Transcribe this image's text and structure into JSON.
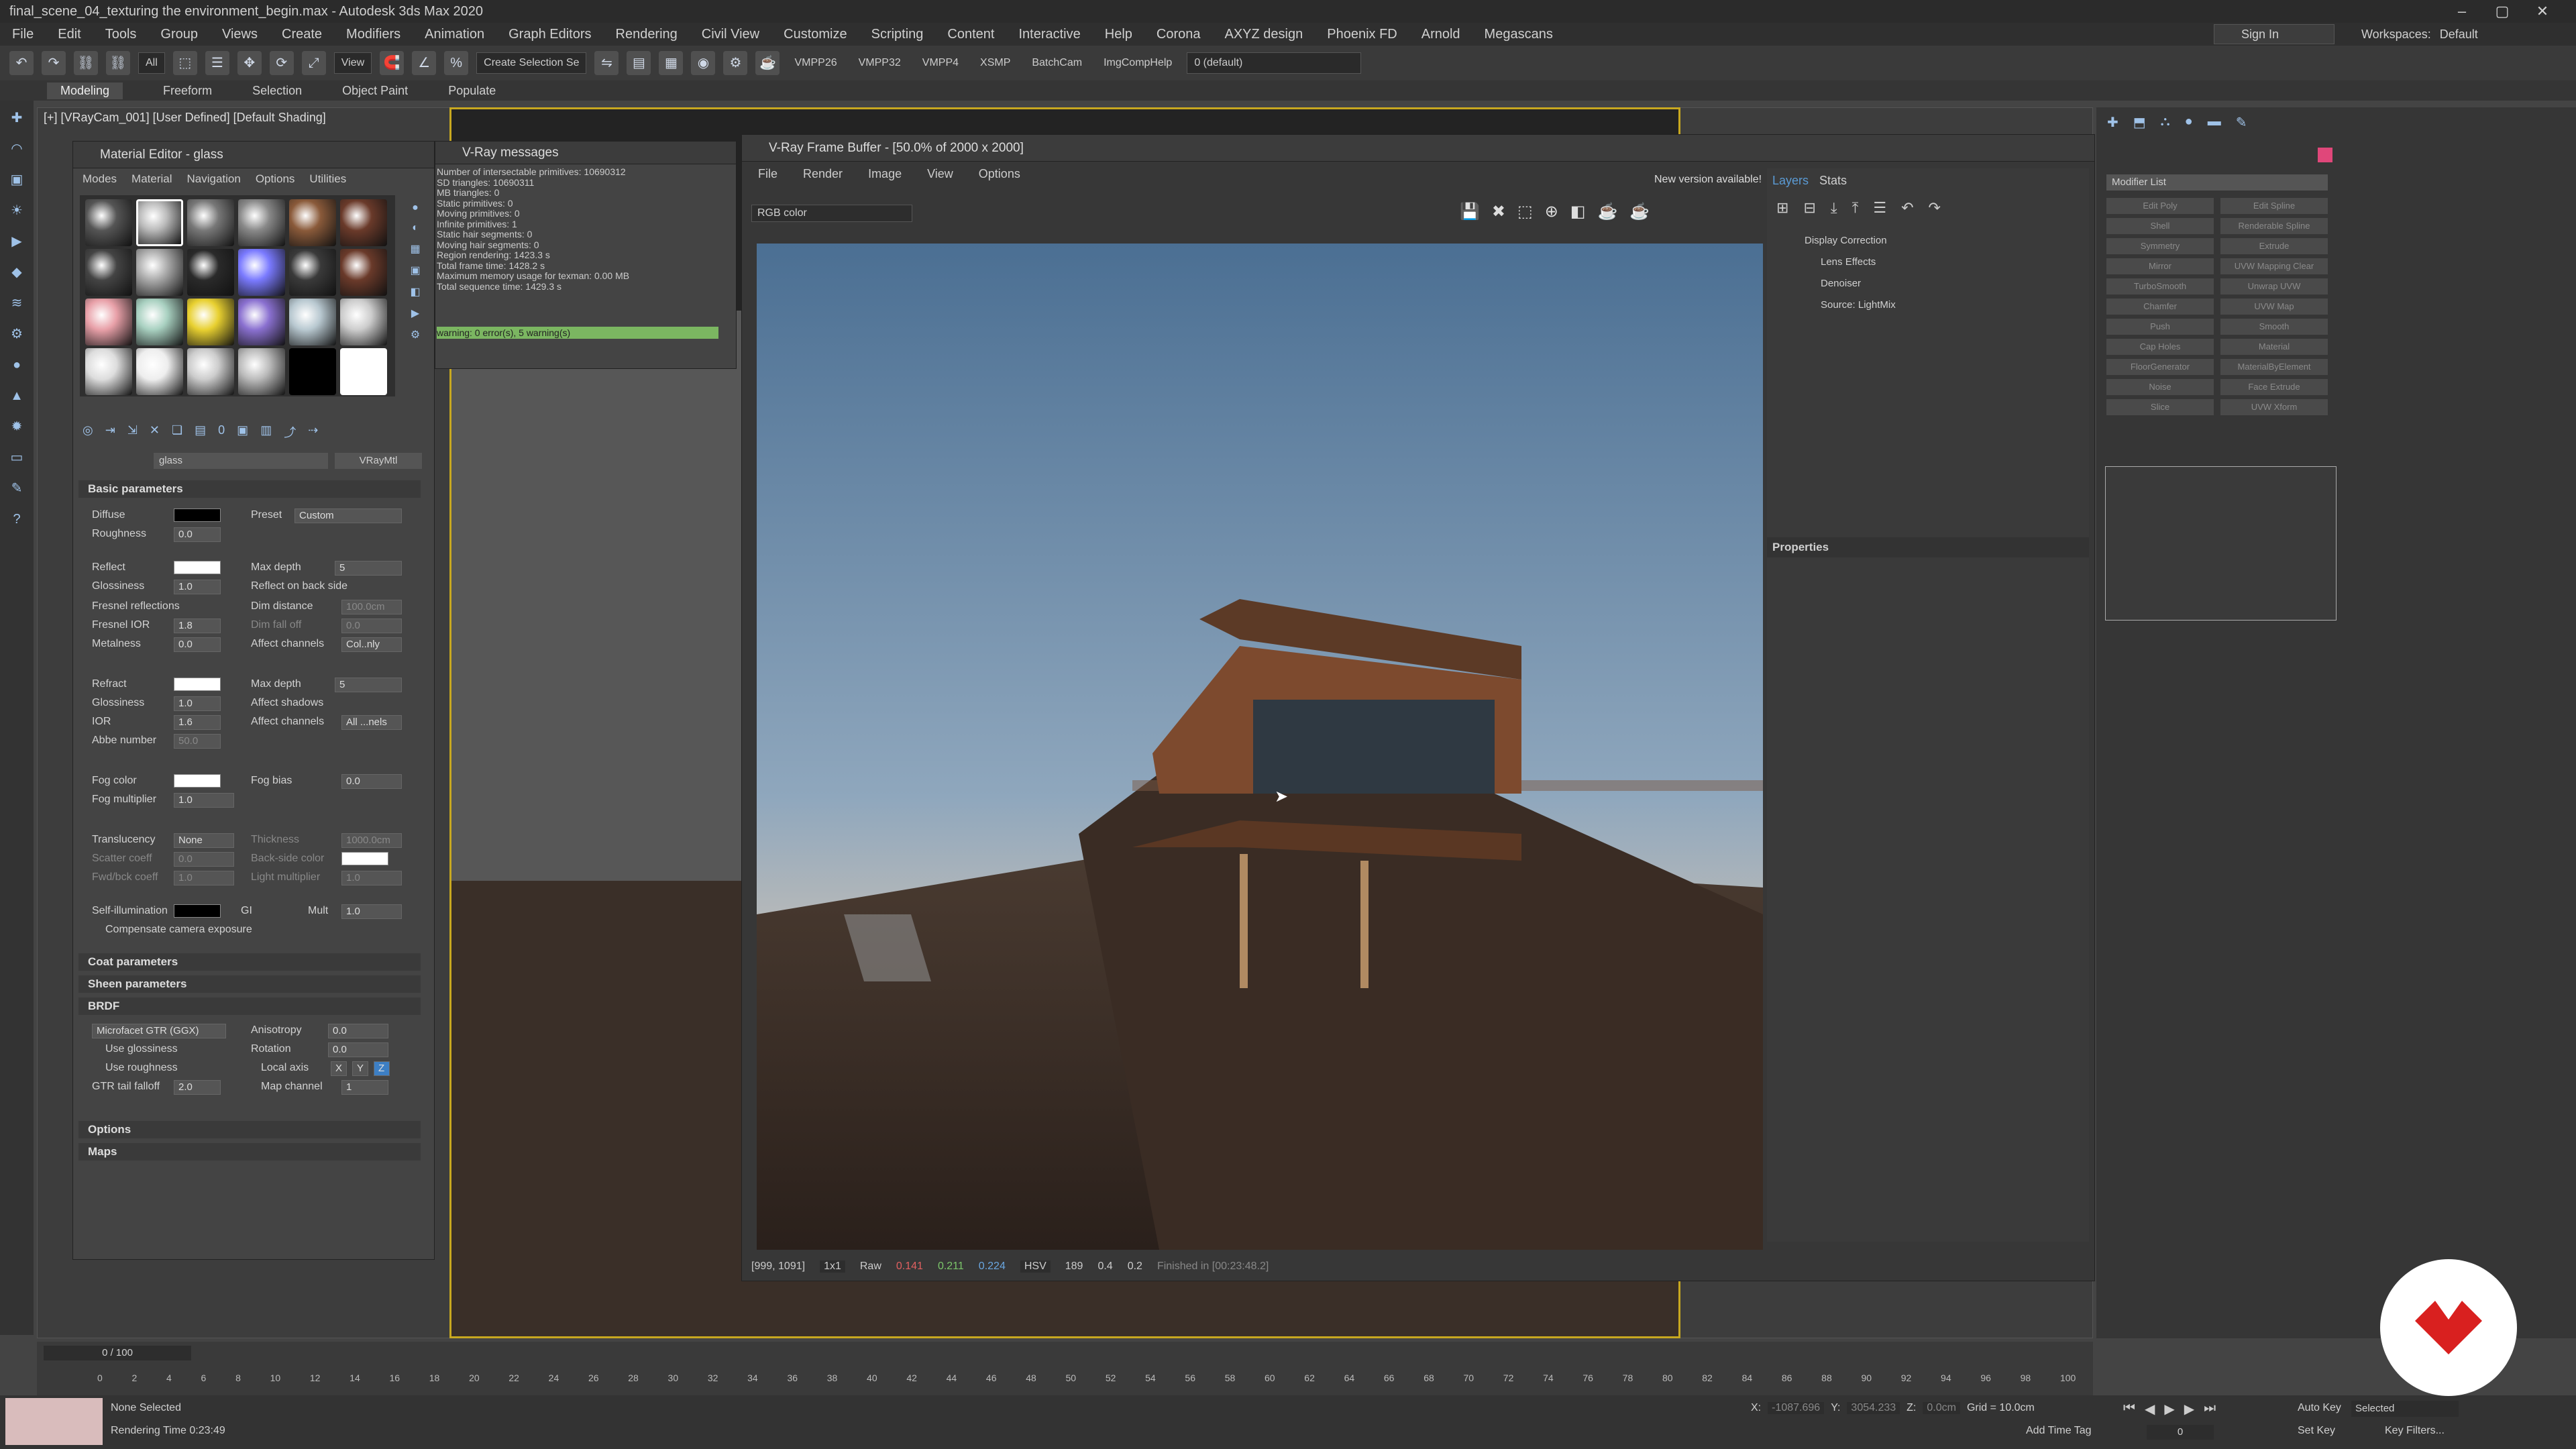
{
  "window": {
    "title": "final_scene_04_texturing the environment_begin.max - Autodesk 3ds Max 2020",
    "controls": [
      "–",
      "▢",
      "✕"
    ]
  },
  "menu": [
    "File",
    "Edit",
    "Tools",
    "Group",
    "Views",
    "Create",
    "Modifiers",
    "Animation",
    "Graph Editors",
    "Rendering",
    "Civil View",
    "Customize",
    "Scripting",
    "Content",
    "Interactive",
    "Help",
    "Corona",
    "AXYZ design",
    "Phoenix FD",
    "Arnold",
    "Megascans"
  ],
  "account": {
    "sign_in": "Sign In",
    "workspaces_label": "Workspaces:",
    "workspace": "Default"
  },
  "toolbar": {
    "selection_filter": "All",
    "ref_coord": "View",
    "create_selection_set": "Create Selection Se",
    "layer": "0 (default)",
    "scripts": [
      "VMPP26",
      "VMPP32",
      "VMPP4",
      "XSMP",
      "BatchCam",
      "ImgCompHelp"
    ]
  },
  "ribbon_tabs": [
    "Modeling",
    "Freeform",
    "Selection",
    "Object Paint",
    "Populate"
  ],
  "viewport": {
    "label": "[+] [VRayCam_001] [User Defined] [Default Shading]"
  },
  "material_editor": {
    "title": "Material Editor - glass",
    "menu": [
      "Modes",
      "Material",
      "Navigation",
      "Options",
      "Utilities"
    ],
    "material_name": "glass",
    "material_type": "VRayMtl",
    "basic_params_title": "Basic parameters",
    "diffuse_label": "Diffuse",
    "preset_label": "Preset",
    "preset_value": "Custom",
    "roughness_label": "Roughness",
    "roughness": "0.0",
    "reflect_label": "Reflect",
    "max_depth_label": "Max depth",
    "reflect_max_depth": "5",
    "glossiness_label": "Glossiness",
    "reflect_glossiness": "1.0",
    "reflect_back_side": "Reflect on back side",
    "fresnel_reflections": "Fresnel reflections",
    "dim_distance": "Dim distance",
    "dim_distance_value": "100.0cm",
    "fresnel_ior_label": "Fresnel IOR",
    "fresnel_ior": "1.8",
    "dim_falloff": "Dim fall off",
    "dim_falloff_value": "0.0",
    "metalness_label": "Metalness",
    "metalness": "0.0",
    "affect_channels_label": "Affect channels",
    "reflect_affect": "Col..nly",
    "refract_label": "Refract",
    "refract_max_depth": "5",
    "refract_glossiness": "1.0",
    "affect_shadows": "Affect shadows",
    "ior_label": "IOR",
    "ior": "1.6",
    "refract_affect": "All ...nels",
    "abbe_label": "Abbe number",
    "abbe": "50.0",
    "fog_color_label": "Fog color",
    "fog_bias_label": "Fog bias",
    "fog_bias": "0.0",
    "fog_mult_label": "Fog multiplier",
    "fog_mult": "1.0",
    "translucency_label": "Translucency",
    "translucency": "None",
    "thickness_label": "Thickness",
    "thickness": "1000.0cm",
    "scatter_label": "Scatter coeff",
    "scatter": "0.0",
    "backside_label": "Back-side color",
    "fwdbck_label": "Fwd/bck coeff",
    "fwdbck": "1.0",
    "light_mult_label": "Light multiplier",
    "light_mult": "1.0",
    "self_illum_label": "Self-illumination",
    "gi_label": "GI",
    "mult_label": "Mult",
    "mult": "1.0",
    "compensate_label": "Compensate camera exposure",
    "rollouts": [
      "Coat parameters",
      "Sheen parameters",
      "BRDF"
    ],
    "brdf_type": "Microfacet GTR (GGX)",
    "anisotropy_label": "Anisotropy",
    "anisotropy": "0.0",
    "use_glossiness": "Use glossiness",
    "rotation_label": "Rotation",
    "rotation": "0.0",
    "use_roughness": "Use roughness",
    "local_axis_label": "Local axis",
    "axis_x": "X",
    "axis_y": "Y",
    "axis_z": "Z",
    "gtr_falloff_label": "GTR tail falloff",
    "gtr_falloff": "2.0",
    "map_channel_label": "Map channel",
    "map_channel": "1",
    "rollouts_bottom": [
      "Options",
      "Maps"
    ]
  },
  "vray_messages": {
    "title": "V-Ray messages",
    "lines": [
      "Number of intersectable primitives: 10690312",
      "SD triangles: 10690311",
      "MB triangles: 0",
      "Static primitives: 0",
      "Moving primitives: 0",
      "Infinite primitives: 1",
      "Static hair segments: 0",
      "Moving hair segments: 0",
      "Region rendering: 1423.3 s",
      "Total frame time: 1428.2 s",
      "Maximum memory usage for texman: 0.00 MB",
      "Total sequence time: 1429.3 s"
    ],
    "warning": "warning: 0 error(s), 5 warning(s)"
  },
  "vfb": {
    "title": "V-Ray Frame Buffer - [50.0% of 2000 x 2000]",
    "menu": [
      "File",
      "Render",
      "Image",
      "View",
      "Options"
    ],
    "new_version": "New version available!",
    "channel": "RGB color",
    "tabs": [
      "Layers",
      "Stats"
    ],
    "layers": [
      "Display Correction",
      "Lens Effects",
      "Denoiser",
      "Source: LightMix"
    ],
    "properties_label": "Properties",
    "coords": "[999, 1091]",
    "zoom": "1x1",
    "mode": "Raw",
    "r": "0.141",
    "g": "0.211",
    "b": "0.224",
    "color_mode": "HSV",
    "h": "189",
    "s": "0.4",
    "v": "0.2",
    "finished": "Finished in [00:23:48.2]"
  },
  "modifier_panel": {
    "list_label": "Modifier List",
    "buttons": [
      "Edit Poly",
      "Edit Spline",
      "Shell",
      "Renderable Spline",
      "Symmetry",
      "Extrude",
      "Mirror",
      "UVW Mapping Clear",
      "TurboSmooth",
      "Unwrap UVW",
      "Chamfer",
      "UVW Map",
      "Push",
      "Smooth",
      "Cap Holes",
      "Material",
      "FloorGenerator",
      "MaterialByElement",
      "Noise",
      "Face Extrude",
      "Slice",
      "UVW Xform"
    ]
  },
  "timeline": {
    "frame": "0 / 100",
    "ticks": [
      "0",
      "2",
      "4",
      "6",
      "8",
      "10",
      "12",
      "14",
      "16",
      "18",
      "20",
      "22",
      "24",
      "26",
      "28",
      "30",
      "32",
      "34",
      "36",
      "38",
      "40",
      "42",
      "44",
      "46",
      "48",
      "50",
      "52",
      "54",
      "56",
      "58",
      "60",
      "62",
      "64",
      "66",
      "68",
      "70",
      "72",
      "74",
      "76",
      "78",
      "80",
      "82",
      "84",
      "86",
      "88",
      "90",
      "92",
      "94",
      "96",
      "98",
      "100"
    ]
  },
  "status": {
    "selection": "None Selected",
    "render_time": "Rendering Time 0:23:49",
    "x_label": "X:",
    "x": "-1087.696",
    "y_label": "Y:",
    "y": "3054.233",
    "z_label": "Z:",
    "z": "0.0cm",
    "grid": "Grid = 10.0cm",
    "add_time_tag": "Add Time Tag",
    "auto_key": "Auto Key",
    "selected": "Selected",
    "set_key": "Set Key",
    "key_filters": "Key Filters...",
    "frame_value": "0"
  },
  "colors": {
    "accent_blue": "#5b9bd5",
    "warning_green": "#7bb661",
    "brand_red": "#d9201f",
    "swatch_pink": "#e0477a"
  }
}
